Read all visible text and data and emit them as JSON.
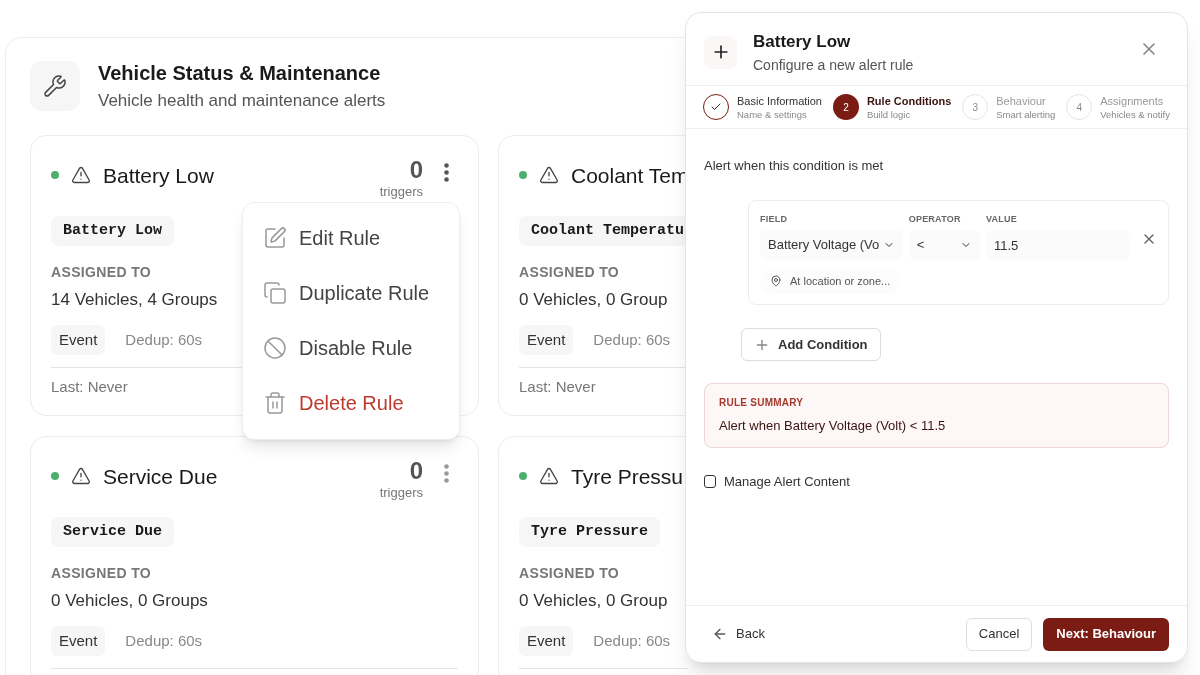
{
  "section": {
    "title": "Vehicle Status & Maintenance",
    "subtitle": "Vehicle health and maintenance alerts"
  },
  "rules": [
    {
      "active": true,
      "title": "Battery Low",
      "count": "0",
      "count_label": "triggers",
      "tag": "Battery Low",
      "assigned_label": "ASSIGNED TO",
      "assigned": "14 Vehicles, 4 Groups",
      "type": "Event",
      "dedup": "Dedup: 60s",
      "last": "Last: Never",
      "menu_open": true
    },
    {
      "active": true,
      "title": "Coolant Tem",
      "tag": "Coolant Temperatu",
      "assigned_label": "ASSIGNED TO",
      "assigned": "0 Vehicles, 0 Group",
      "type": "Event",
      "dedup": "Dedup: 60s",
      "last": "Last: Never"
    },
    {
      "active": true,
      "title": "Service Due",
      "count": "0",
      "count_label": "triggers",
      "tag": "Service Due",
      "assigned_label": "ASSIGNED TO",
      "assigned": "0 Vehicles, 0 Groups",
      "type": "Event",
      "dedup": "Dedup: 60s",
      "menu_open": false
    },
    {
      "active": true,
      "title": "Tyre Pressu",
      "tag": "Tyre Pressure",
      "assigned_label": "ASSIGNED TO",
      "assigned": "0 Vehicles, 0 Group",
      "type": "Event",
      "dedup": "Dedup: 60s"
    }
  ],
  "menu": [
    {
      "label": "Edit Rule",
      "kind": "normal"
    },
    {
      "label": "Duplicate Rule",
      "kind": "normal"
    },
    {
      "label": "Disable Rule",
      "kind": "normal"
    },
    {
      "label": "Delete Rule",
      "kind": "danger"
    }
  ],
  "dialog": {
    "title": "Battery Low",
    "subtitle": "Configure a new alert rule",
    "steps": [
      {
        "title": "Basic Information",
        "subtitle": "Name & settings",
        "completed": true,
        "selected": false
      },
      {
        "number": "2",
        "title": "Rule Conditions",
        "subtitle": "Build logic",
        "completed": false,
        "selected": true
      },
      {
        "number": "3",
        "title": "Behaviour",
        "subtitle": "Smart alerting",
        "completed": false,
        "selected": false
      },
      {
        "number": "4",
        "title": "Assignments",
        "subtitle": "Vehicles & notify",
        "completed": false,
        "selected": false
      }
    ],
    "intro": "Alert when this condition is met",
    "condition": {
      "field_label": "FIELD",
      "field": "Battery Voltage (Vo",
      "operator_label": "OPERATOR",
      "operator": "<",
      "value_label": "VALUE",
      "value": "11.5",
      "location_placeholder": "At location or zone..."
    },
    "add_condition": "Add Condition",
    "summary": {
      "label": "RULE SUMMARY",
      "text": "Alert when Battery Voltage (Volt) < 11.5"
    },
    "manage_content": {
      "label": "Manage Alert Content",
      "checked": false
    },
    "back": "Back",
    "cancel": "Cancel",
    "next": "Next: Behaviour"
  }
}
